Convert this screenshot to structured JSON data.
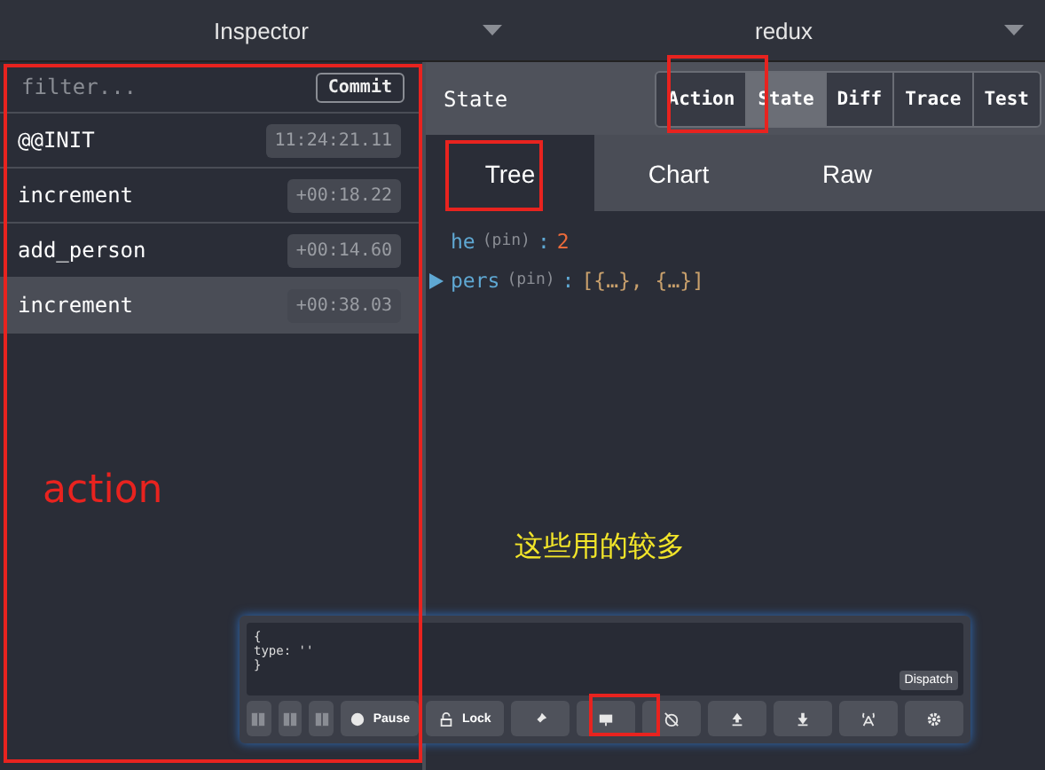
{
  "top_bar": [
    {
      "label": "Inspector"
    },
    {
      "label": "redux"
    }
  ],
  "action_list": {
    "filter_placeholder": "filter...",
    "commit": "Commit",
    "rows": [
      {
        "name": "@@INIT",
        "time": "11:24:21.11",
        "selected": false
      },
      {
        "name": "increment",
        "time": "+00:18.22",
        "selected": false
      },
      {
        "name": "add_person",
        "time": "+00:14.60",
        "selected": false
      },
      {
        "name": "increment",
        "time": "+00:38.03",
        "selected": true
      }
    ]
  },
  "inspector": {
    "title": "State",
    "tabs": [
      {
        "label": "Action",
        "selected": false
      },
      {
        "label": "State",
        "selected": true
      },
      {
        "label": "Diff",
        "selected": false
      },
      {
        "label": "Trace",
        "selected": false
      },
      {
        "label": "Test",
        "selected": false
      }
    ],
    "subtabs": [
      {
        "label": "Tree",
        "selected": true
      },
      {
        "label": "Chart",
        "selected": false
      },
      {
        "label": "Raw",
        "selected": false
      }
    ],
    "tree": [
      {
        "key": "he",
        "tag": "(pin)",
        "separator": ":",
        "value": "2",
        "kind": "number",
        "expandable": false
      },
      {
        "key": "pers",
        "tag": "(pin)",
        "separator": ":",
        "value": "[{…}, {…}]",
        "kind": "array",
        "expandable": true
      }
    ]
  },
  "dispatcher": {
    "code": [
      "{",
      "type: ''",
      "}"
    ],
    "dispatch": "Dispatch",
    "buttons": [
      {
        "kind": "small"
      },
      {
        "kind": "small"
      },
      {
        "kind": "small"
      },
      {
        "kind": "label",
        "label": "Pause"
      },
      {
        "kind": "label",
        "label": "Lock"
      },
      {
        "kind": "icon"
      },
      {
        "kind": "icon"
      },
      {
        "kind": "icon"
      },
      {
        "kind": "icon"
      },
      {
        "kind": "icon"
      },
      {
        "kind": "icon"
      },
      {
        "kind": "icon"
      }
    ]
  },
  "annotations": [
    {
      "text": "action",
      "color": "#e8231f"
    },
    {
      "text": "这些用的较多",
      "color": "#f2e529"
    }
  ]
}
